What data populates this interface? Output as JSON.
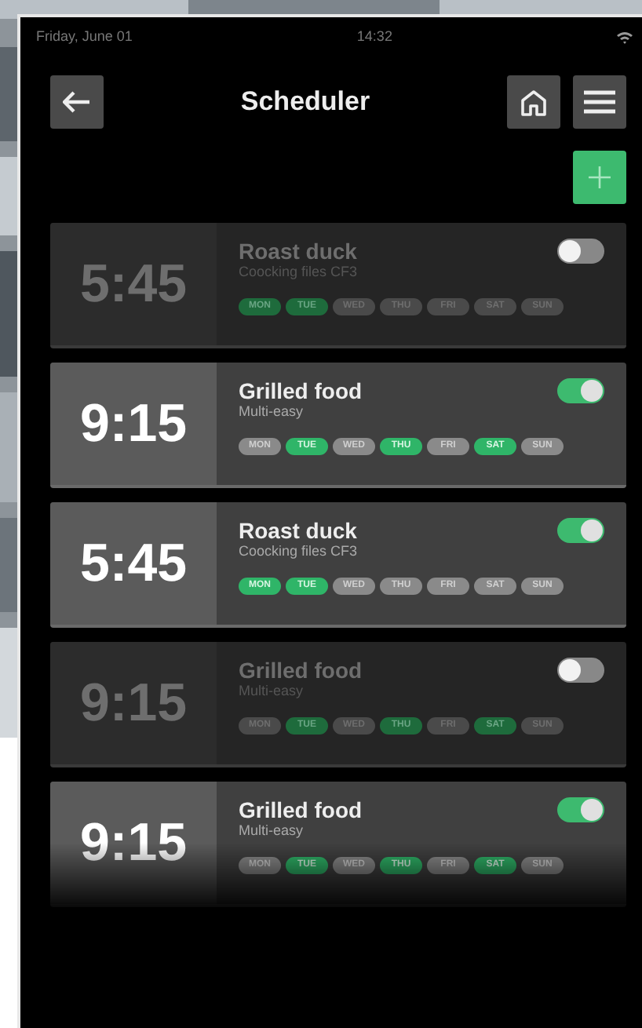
{
  "status_bar": {
    "date": "Friday, June 01",
    "time": "14:32"
  },
  "header": {
    "title": "Scheduler"
  },
  "schedules": [
    {
      "time": "5:45",
      "name": "Roast duck",
      "program": "Coocking files CF3",
      "on": false,
      "days": [
        {
          "label": "MON",
          "selected": true
        },
        {
          "label": "TUE",
          "selected": true
        },
        {
          "label": "WED",
          "selected": false
        },
        {
          "label": "THU",
          "selected": false
        },
        {
          "label": "FRI",
          "selected": false
        },
        {
          "label": "SAT",
          "selected": false
        },
        {
          "label": "SUN",
          "selected": false
        }
      ]
    },
    {
      "time": "9:15",
      "name": "Grilled food",
      "program": "Multi-easy",
      "on": true,
      "days": [
        {
          "label": "MON",
          "selected": false
        },
        {
          "label": "TUE",
          "selected": true
        },
        {
          "label": "WED",
          "selected": false
        },
        {
          "label": "THU",
          "selected": true
        },
        {
          "label": "FRI",
          "selected": false
        },
        {
          "label": "SAT",
          "selected": true
        },
        {
          "label": "SUN",
          "selected": false
        }
      ]
    },
    {
      "time": "5:45",
      "name": "Roast duck",
      "program": "Coocking files CF3",
      "on": true,
      "days": [
        {
          "label": "MON",
          "selected": true
        },
        {
          "label": "TUE",
          "selected": true
        },
        {
          "label": "WED",
          "selected": false
        },
        {
          "label": "THU",
          "selected": false
        },
        {
          "label": "FRI",
          "selected": false
        },
        {
          "label": "SAT",
          "selected": false
        },
        {
          "label": "SUN",
          "selected": false
        }
      ]
    },
    {
      "time": "9:15",
      "name": "Grilled food",
      "program": "Multi-easy",
      "on": false,
      "days": [
        {
          "label": "MON",
          "selected": false
        },
        {
          "label": "TUE",
          "selected": true
        },
        {
          "label": "WED",
          "selected": false
        },
        {
          "label": "THU",
          "selected": true
        },
        {
          "label": "FRI",
          "selected": false
        },
        {
          "label": "SAT",
          "selected": true
        },
        {
          "label": "SUN",
          "selected": false
        }
      ]
    },
    {
      "time": "9:15",
      "name": "Grilled food",
      "program": "Multi-easy",
      "on": true,
      "days": [
        {
          "label": "MON",
          "selected": false
        },
        {
          "label": "TUE",
          "selected": true
        },
        {
          "label": "WED",
          "selected": false
        },
        {
          "label": "THU",
          "selected": true
        },
        {
          "label": "FRI",
          "selected": false
        },
        {
          "label": "SAT",
          "selected": true
        },
        {
          "label": "SUN",
          "selected": false
        }
      ]
    }
  ]
}
